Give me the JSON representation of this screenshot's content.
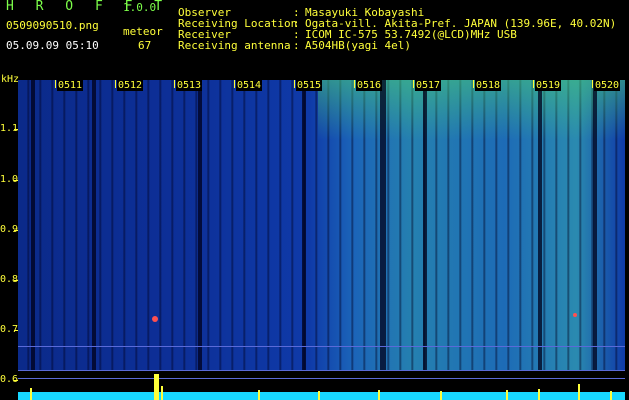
{
  "app": {
    "title": "H R O F F T",
    "version": "1.0.0",
    "filename": "0509090510.png",
    "datetime": "05.09.09 05:10",
    "mode_label": "meteor",
    "meteor_count": "67"
  },
  "info": [
    {
      "label": "Observer",
      "value": "Masayuki Kobayashi"
    },
    {
      "label": "Receiving Location",
      "value": "Ogata-vill. Akita-Pref. JAPAN (139.96E, 40.02N)"
    },
    {
      "label": "Receiver",
      "value": "ICOM IC-575 53.7492(@LCD)MHz USB"
    },
    {
      "label": "Receiving antenna",
      "value": "A504HB(yagi 4el)"
    }
  ],
  "axis": {
    "unit": "kHz",
    "ticks": [
      "1.1",
      "1.0",
      "0.9",
      "0.8",
      "0.7",
      "0.6"
    ]
  },
  "time_labels": [
    "0511",
    "0512",
    "0513",
    "0514",
    "0515",
    "0516",
    "0517",
    "0518",
    "0519",
    "0520"
  ],
  "colors": {
    "header_text": "#ffff3a",
    "title_text": "#7dff4a",
    "background": "#000000",
    "spectrum_low": "#0b2a8a",
    "spectrum_high": "#18d8ff"
  }
}
